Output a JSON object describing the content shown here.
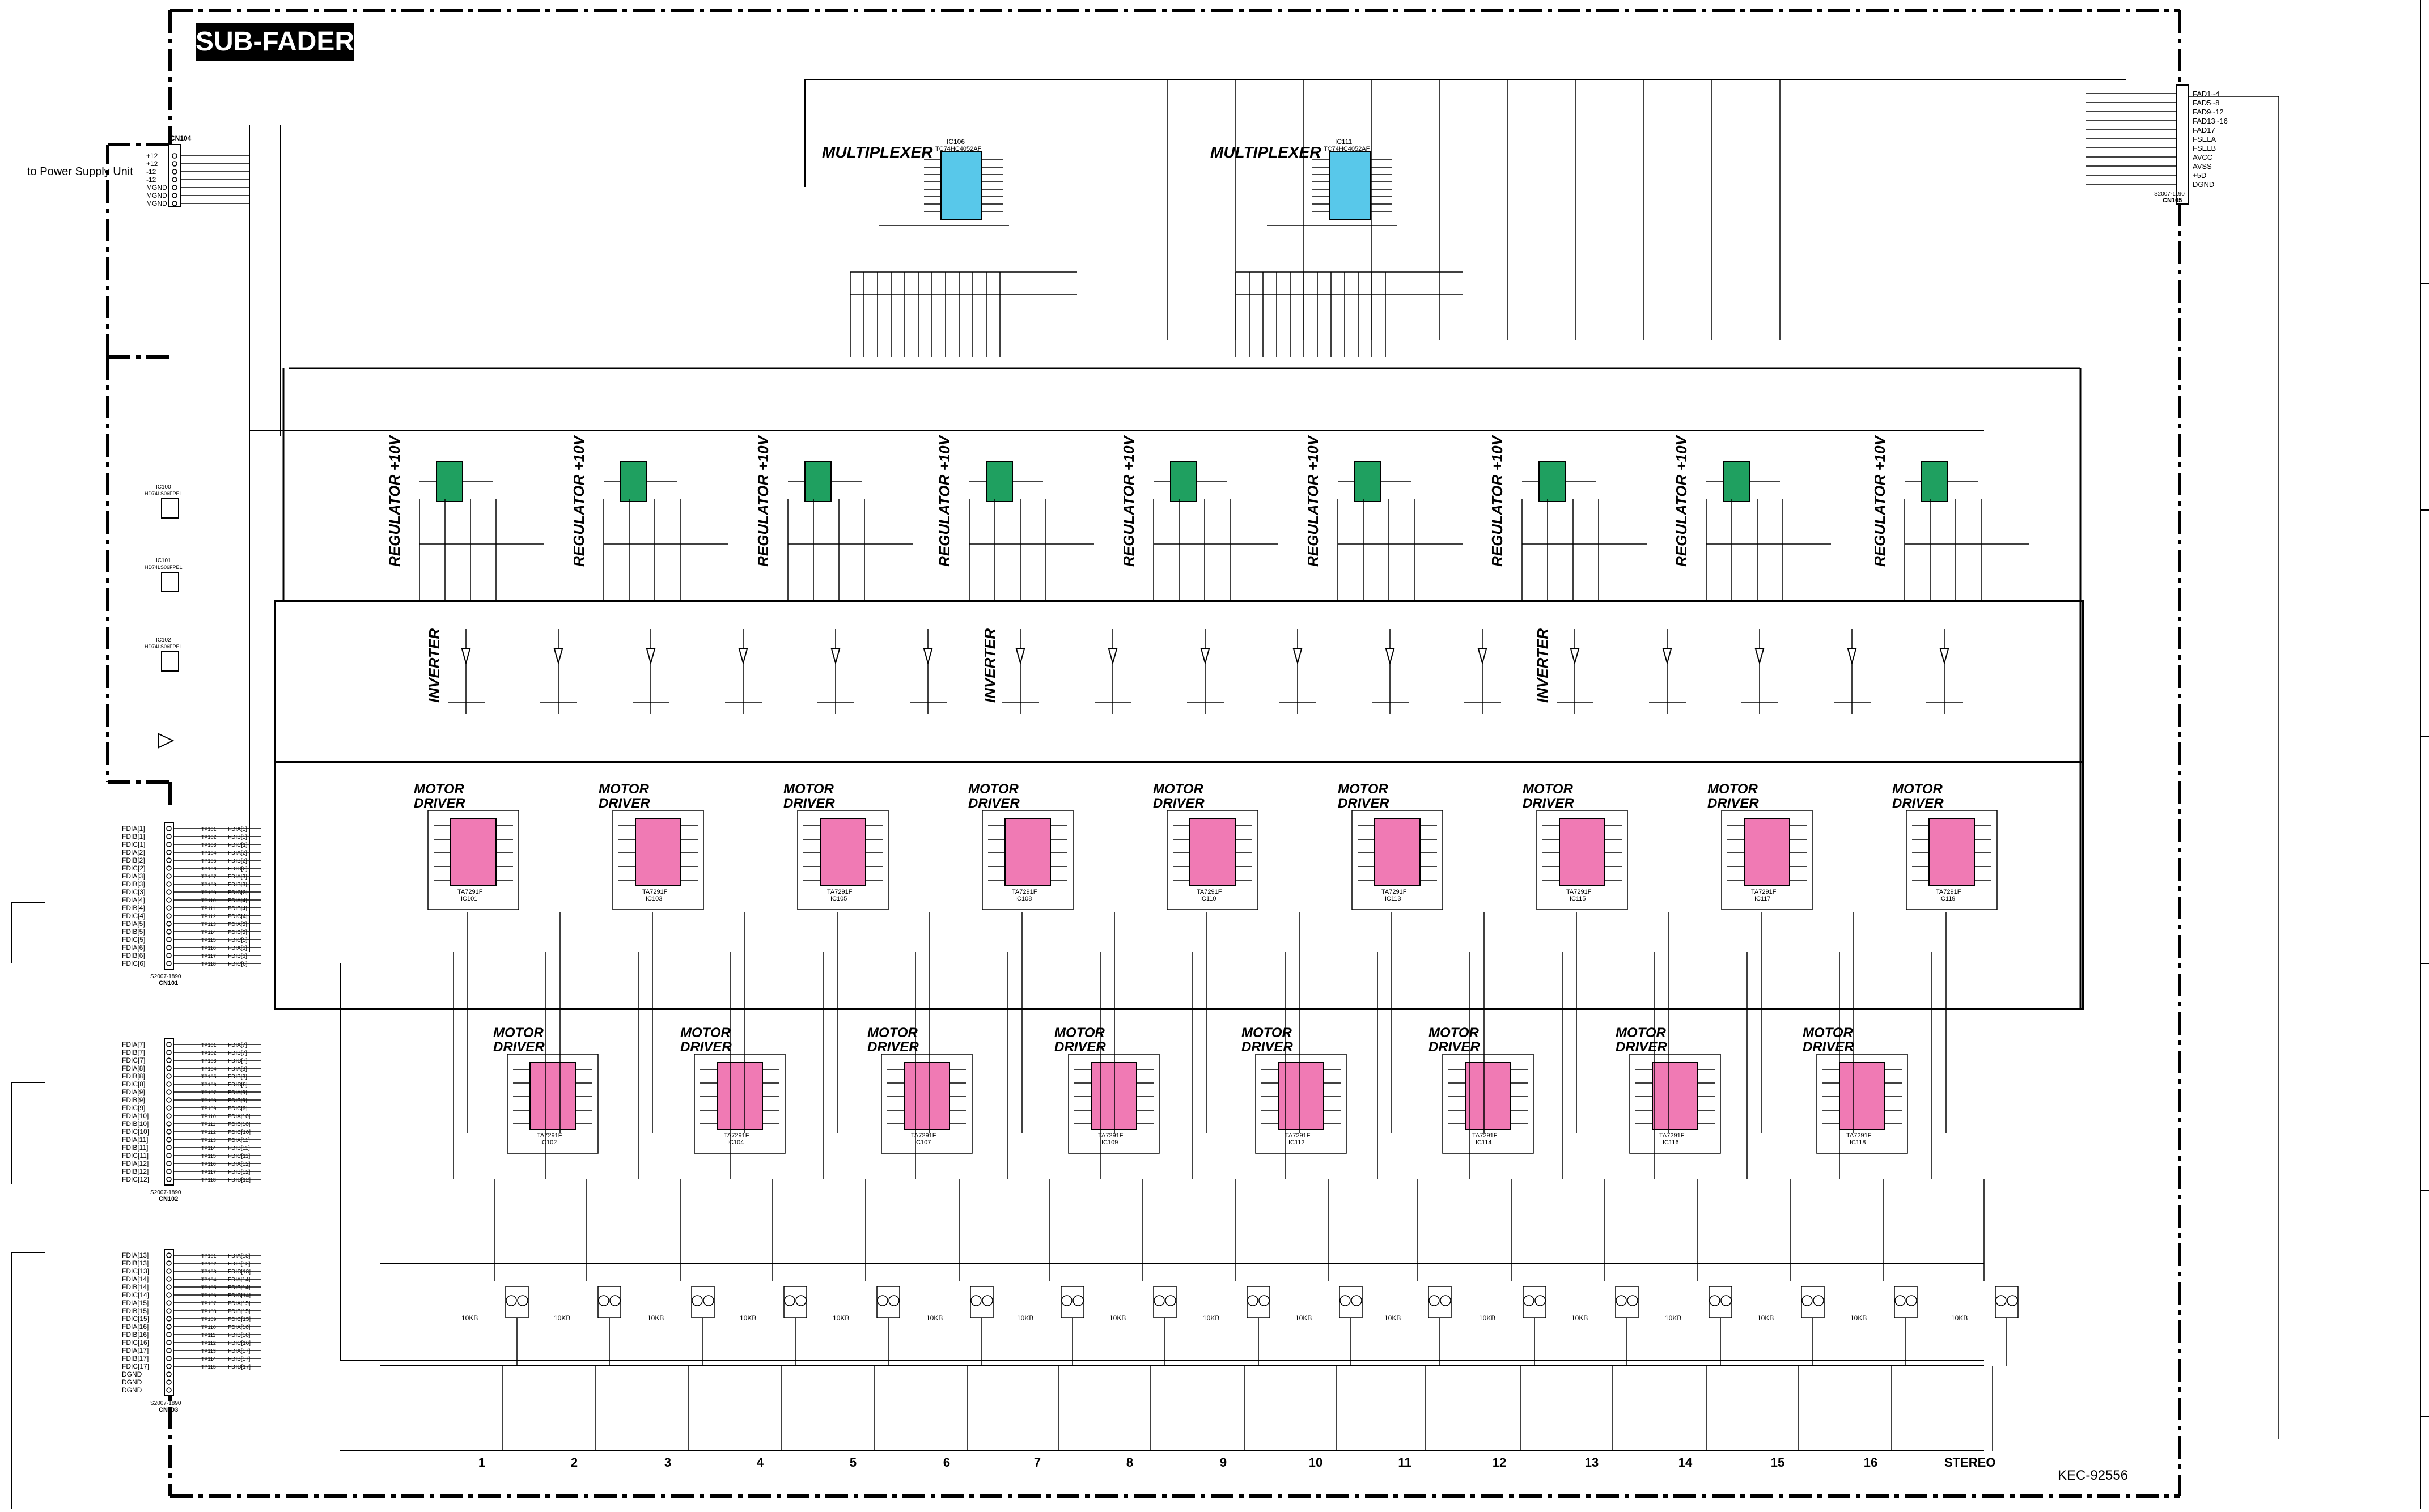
{
  "title": "SUB-FADER",
  "power_label": "to Power Supply Unit",
  "document_number": "KEC-92556",
  "colors": {
    "multiplexer": "#58c8ea",
    "regulator": "#1fa060",
    "motor_driver": "#f07ab4",
    "line": "#000000"
  },
  "multiplexer": {
    "label": "MULTIPLEXER",
    "units": [
      {
        "ref": "IC106",
        "part": "TC74HC4052AF"
      },
      {
        "ref": "IC111",
        "part": "TC74HC4052AF"
      }
    ]
  },
  "regulator": {
    "label": "REGULATOR +10V",
    "count": 9
  },
  "inverter": {
    "label": "INVERTER",
    "part": "HD74LS06FPEL",
    "count": 3
  },
  "motor_driver": {
    "label_line1": "MOTOR",
    "label_line2": "DRIVER",
    "part": "TA7291F",
    "top_row_refs": [
      "IC101",
      "IC103",
      "IC105",
      "IC108",
      "IC110",
      "IC113",
      "IC115",
      "IC117",
      "IC119"
    ],
    "bottom_row_refs": [
      "IC102",
      "IC104",
      "IC107",
      "IC109",
      "IC112",
      "IC114",
      "IC116",
      "IC118"
    ]
  },
  "connectors": {
    "power": {
      "ref": "CN104",
      "pins": [
        "+12",
        "+12",
        "-12",
        "-12",
        "MGND",
        "MGND",
        "MGND"
      ]
    },
    "cn101": {
      "ref": "CN101",
      "part": "S2007-1890",
      "left": [
        "FDIA[1]",
        "FDIB[1]",
        "FDIC[1]",
        "FDIA[2]",
        "FDIB[2]",
        "FDIC[2]",
        "FDIA[3]",
        "FDIB[3]",
        "FDIC[3]",
        "FDIA[4]",
        "FDIB[4]",
        "FDIC[4]",
        "FDIA[5]",
        "FDIB[5]",
        "FDIC[5]",
        "FDIA[6]",
        "FDIB[6]",
        "FDIC[6]"
      ],
      "right": [
        "FDIA[1]",
        "FDIB[1]",
        "FDIC[1]",
        "FDIA[2]",
        "FDIB[2]",
        "FDIC[2]",
        "FDIA[3]",
        "FDIB[3]",
        "FDIC[3]",
        "FDIA[4]",
        "FDIB[4]",
        "FDIC[4]",
        "FDIA[5]",
        "FDIB[5]",
        "FDIC[5]",
        "FDIA[6]",
        "FDIB[6]",
        "FDIC[6]"
      ]
    },
    "cn102": {
      "ref": "CN102",
      "part": "S2007-1890",
      "left": [
        "FDIA[7]",
        "FDIB[7]",
        "FDIC[7]",
        "FDIA[8]",
        "FDIB[8]",
        "FDIC[8]",
        "FDIA[9]",
        "FDIB[9]",
        "FDIC[9]",
        "FDIA[10]",
        "FDIB[10]",
        "FDIC[10]",
        "FDIA[11]",
        "FDIB[11]",
        "FDIC[11]",
        "FDIA[12]",
        "FDIB[12]",
        "FDIC[12]"
      ],
      "right": [
        "FDIA[7]",
        "FDIB[7]",
        "FDIC[7]",
        "FDIA[8]",
        "FDIB[8]",
        "FDIC[8]",
        "FDIA[9]",
        "FDIB[9]",
        "FDIC[9]",
        "FDIA[10]",
        "FDIB[10]",
        "FDIC[10]",
        "FDIA[11]",
        "FDIB[11]",
        "FDIC[11]",
        "FDIA[12]",
        "FDIB[12]",
        "FDIC[12]"
      ]
    },
    "cn103": {
      "ref": "CN103",
      "part": "S2007-1890",
      "left": [
        "FDIA[13]",
        "FDIB[13]",
        "FDIC[13]",
        "FDIA[14]",
        "FDIB[14]",
        "FDIC[14]",
        "FDIA[15]",
        "FDIB[15]",
        "FDIC[15]",
        "FDIA[16]",
        "FDIB[16]",
        "FDIC[16]",
        "FDIA[17]",
        "FDIB[17]",
        "FDIC[17]",
        "DGND",
        "DGND",
        "DGND"
      ],
      "right": [
        "FDIA[13]",
        "FDIB[13]",
        "FDIC[13]",
        "FDIA[14]",
        "FDIB[14]",
        "FDIC[14]",
        "FDIA[15]",
        "FDIB[15]",
        "FDIC[15]",
        "FDIA[16]",
        "FDIB[16]",
        "FDIC[16]",
        "FDIA[17]",
        "FDIB[17]",
        "FDIC[17]"
      ]
    },
    "cn105": {
      "ref": "CN105",
      "part": "S2007-1190",
      "pins": [
        "FAD1~4",
        "FAD5~8",
        "FAD9~12",
        "FAD13~16",
        "FAD17",
        "FSELA",
        "FSELB",
        "AVCC",
        "AVSS",
        "+5D",
        "DGND"
      ]
    }
  },
  "channels": [
    "1",
    "2",
    "3",
    "4",
    "5",
    "6",
    "7",
    "8",
    "9",
    "10",
    "11",
    "12",
    "13",
    "14",
    "15",
    "16",
    "STEREO"
  ],
  "fader": {
    "value": "10KB"
  }
}
